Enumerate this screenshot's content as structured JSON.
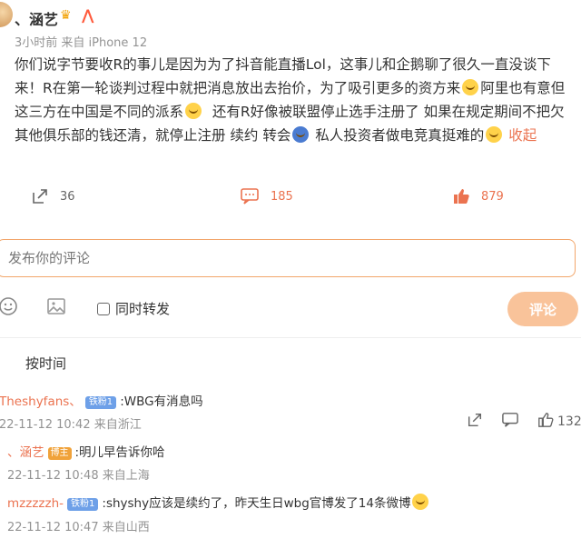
{
  "post": {
    "author": "、涵艺",
    "meta": "3小时前 来自 iPhone 12",
    "text_parts": [
      "你们说字节要收R的事儿是因为为了抖音能直播Lol，这事儿和企鹅聊了很久一直没谈下来！R在第一轮谈判过程中就把消息放出去抬价，为了吸引更多的资方来",
      "阿里也有意但这三方在中国是不同的派系",
      "还有R好像被联盟停止选手注册了 如果在规定期间不把欠其他俱乐部的钱还清，就停止注册 续约 转会",
      "私人投资者做电竞真挺难的",
      "收起"
    ]
  },
  "actions": {
    "repost_count": "36",
    "comment_count": "185",
    "like_count": "879"
  },
  "composer": {
    "placeholder": "发布你的评论",
    "sync_label": "同时转发",
    "submit_label": "评论"
  },
  "comments": {
    "sort_label": "按时间",
    "items": [
      {
        "name": "Theshyfans、",
        "badge": "铁粉1",
        "text": ":WBG有消息吗",
        "meta": "22-11-12 10:42 来自浙江",
        "like_count": "132"
      },
      {
        "name": "、涵艺",
        "badge": "博主",
        "text": ":明儿早告诉你哈",
        "meta": "22-11-12 10:48 来自上海"
      },
      {
        "name": "mzzzzzh-",
        "badge": "铁粉1",
        "text": ":shyshy应该是续约了，昨天生日wbg官博发了14条微博",
        "meta": "22-11-12 10:47 来自山西"
      }
    ]
  },
  "colors": {
    "accent": "#eb7350",
    "submit_bg": "#f9c39a",
    "input_border": "#f2a66b",
    "fan_badge": "#6ea0e8"
  }
}
